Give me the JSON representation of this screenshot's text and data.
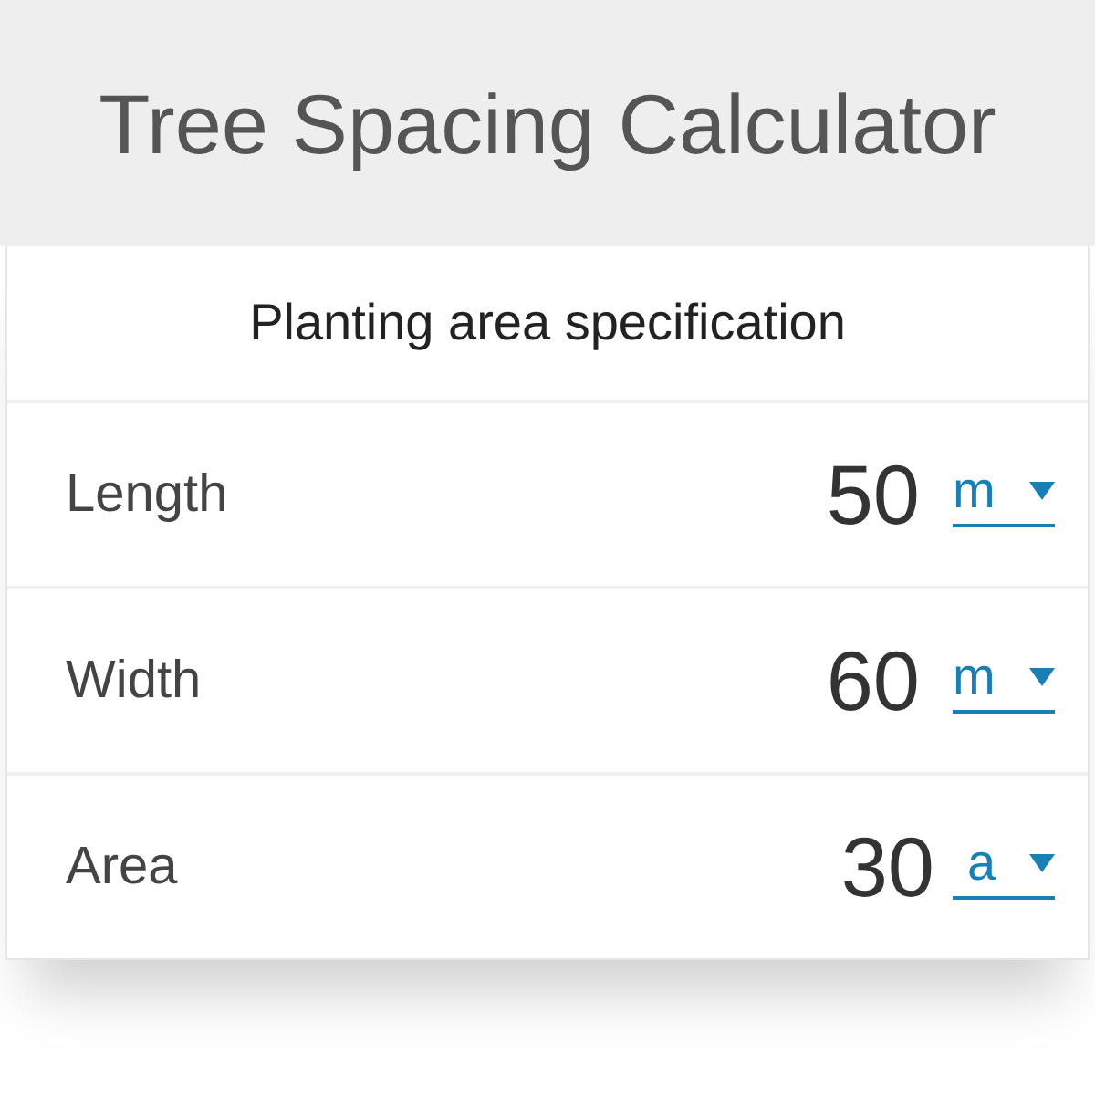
{
  "title": "Tree Spacing Calculator",
  "section": {
    "heading": "Planting area specification"
  },
  "fields": [
    {
      "label": "Length",
      "value": "50",
      "unit": "m"
    },
    {
      "label": "Width",
      "value": "60",
      "unit": "m"
    },
    {
      "label": "Area",
      "value": "30",
      "unit": "a"
    }
  ]
}
